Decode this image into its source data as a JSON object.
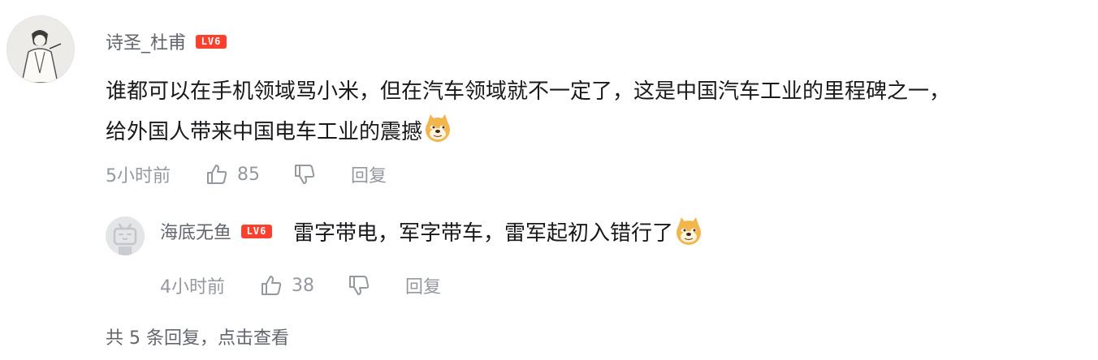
{
  "comment": {
    "username": "诗圣_杜甫",
    "level": "LV6",
    "text_line1": "谁都可以在手机领域骂小米，但在汽车领域就不一定了，这是中国汽车工业的里程碑之一，",
    "text_line2": "给外国人带来中国电车工业的震撼",
    "emoji": "doge-emoji",
    "time": "5小时前",
    "likes": "85",
    "reply_label": "回复"
  },
  "reply": {
    "username": "海底无鱼",
    "level": "LV6",
    "text": "雷字带电，军字带车，雷军起初入错行了",
    "emoji": "doge-emoji",
    "time": "4小时前",
    "likes": "38",
    "reply_label": "回复"
  },
  "more_replies": "共 5 条回复，点击查看",
  "colors": {
    "level_badge": "#ff3f2e",
    "meta_text": "#9499a0",
    "username": "#61666d"
  }
}
